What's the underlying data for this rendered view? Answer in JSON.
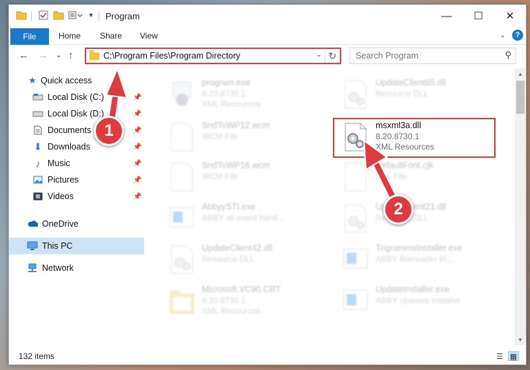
{
  "window": {
    "title": "Program"
  },
  "ribbon": {
    "tabs": [
      "File",
      "Home",
      "Share",
      "View"
    ]
  },
  "address": {
    "path": "C:\\Program Files\\Program Directory"
  },
  "search": {
    "placeholder": "Search Program"
  },
  "sidebar": {
    "quick_access": "Quick access",
    "items": [
      "Local Disk (C:)",
      "Local Disk (D:)",
      "Documents",
      "Downloads",
      "Music",
      "Pictures",
      "Videos"
    ],
    "onedrive": "OneDrive",
    "this_pc": "This PC",
    "network": "Network"
  },
  "files": [
    {
      "name": "program.exe",
      "line1": "8.20.8730.1",
      "line2": "XML Resources",
      "icon": "exe-icon"
    },
    {
      "name": "UpdateClient65.dll",
      "line1": "Resource DLL",
      "line2": "",
      "icon": "dll-icon"
    },
    {
      "name": "SndToWP12.wcm",
      "line1": "WCM File",
      "line2": "",
      "icon": "doc-icon"
    },
    {
      "name": "msxml3a.dll",
      "line1": "8.20.8730.1",
      "line2": "XML Resources",
      "icon": "dll-icon"
    },
    {
      "name": "SndToWP16.wcm",
      "line1": "WCM File",
      "line2": "",
      "icon": "doc-icon"
    },
    {
      "name": "DefaultFont.cjk",
      "line1": "CJK File",
      "line2": "",
      "icon": "doc-icon"
    },
    {
      "name": "AbbyySTI.exe",
      "line1": "ABBY sti event hand...",
      "line2": "",
      "icon": "window-icon"
    },
    {
      "name": "UpdateClient21.dll",
      "line1": "Resource DLL",
      "line2": "",
      "icon": "dll-icon"
    },
    {
      "name": "UpdateClient42.dll",
      "line1": "Resource DLL",
      "line2": "",
      "icon": "dll-icon"
    },
    {
      "name": "TrigrammsInstaller.exe",
      "line1": "ABBY finereader tri...",
      "line2": "",
      "icon": "window-icon"
    },
    {
      "name": "Microsoft.VC90.CRT",
      "line1": "8.20.8730.1",
      "line2": "XML Resources",
      "icon": "folder-icon"
    },
    {
      "name": "UpdateInstaller.exe",
      "line1": "ABBY updates installer",
      "line2": "",
      "icon": "window-icon"
    }
  ],
  "status": {
    "items": "132 items"
  },
  "annotations": {
    "badge1": "1",
    "badge2": "2"
  },
  "colors": {
    "accent": "#1979ca",
    "highlight": "#e03a3e",
    "selected": "#cce4f7"
  }
}
